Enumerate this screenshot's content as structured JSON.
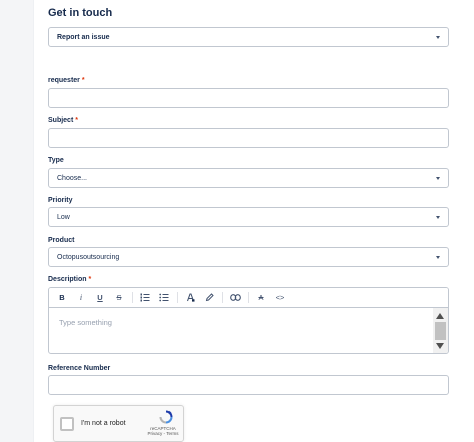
{
  "title": "Get in touch",
  "request_type": {
    "value": "Report an issue"
  },
  "fields": {
    "requester": {
      "label": "requester",
      "required_mark": "*",
      "value": ""
    },
    "subject": {
      "label": "Subject",
      "required_mark": "*",
      "value": ""
    },
    "type": {
      "label": "Type",
      "value": "Choose..."
    },
    "priority": {
      "label": "Priority",
      "value": "Low"
    },
    "product": {
      "label": "Product",
      "value": "Octopusoutsourcing"
    },
    "description": {
      "label": "Description",
      "required_mark": "*",
      "placeholder": "Type something"
    },
    "reference_number": {
      "label": "Reference Number",
      "value": ""
    }
  },
  "toolbar": {
    "bold": "B",
    "italic": "i",
    "underline": "U",
    "strikethrough": "S",
    "clear_format": "A",
    "code": "<>"
  },
  "recaptcha": {
    "label": "I'm not a robot",
    "brand": "reCAPTCHA",
    "links": "Privacy - Terms"
  },
  "colors": {
    "required": "#de350b",
    "border": "#c1c7d0",
    "text": "#172b4d"
  }
}
